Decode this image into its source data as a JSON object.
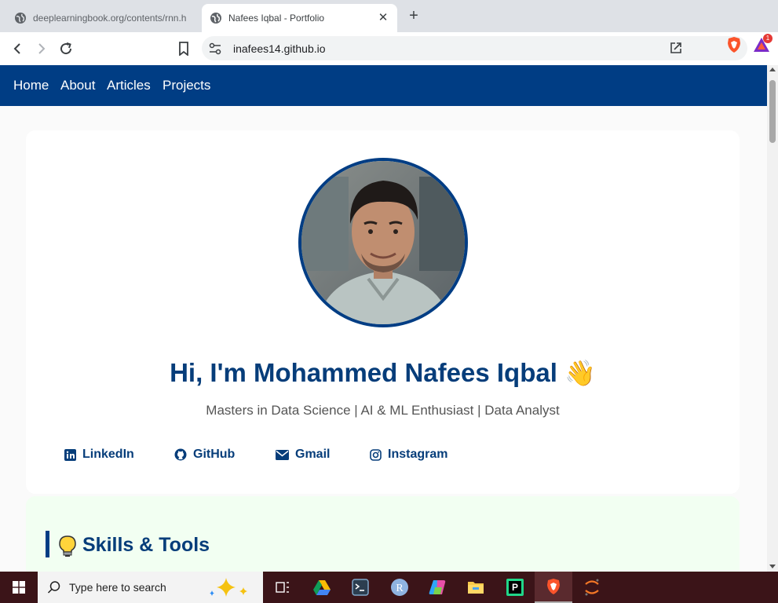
{
  "browser": {
    "tabs": [
      {
        "title": "deeplearningbook.org/contents/rnn.h",
        "active": false
      },
      {
        "title": "Nafees Iqbal - Portfolio",
        "active": true
      }
    ],
    "close_glyph": "✕",
    "newtab_glyph": "+",
    "url": "inafees14.github.io",
    "rewards_badge": "1"
  },
  "nav": {
    "links": [
      "Home",
      "About",
      "Articles",
      "Projects"
    ]
  },
  "hero": {
    "title": "Hi, I'm Mohammed Nafees Iqbal",
    "wave": "👋",
    "subtitle": "Masters in Data Science | AI & ML Enthusiast | Data Analyst",
    "social": [
      {
        "label": "LinkedIn",
        "icon": "linkedin-icon"
      },
      {
        "label": "GitHub",
        "icon": "github-icon"
      },
      {
        "label": "Gmail",
        "icon": "envelope-icon"
      },
      {
        "label": "Instagram",
        "icon": "instagram-icon"
      }
    ]
  },
  "skills": {
    "title": "Skills & Tools",
    "icon": "lightbulb-icon"
  },
  "taskbar": {
    "search_placeholder": "Type here to search",
    "apps": [
      "task-view",
      "google-drive",
      "terminal",
      "r-language",
      "microsoft-copilot",
      "file-explorer",
      "pycharm",
      "brave-browser",
      "jupyter"
    ]
  },
  "colors": {
    "navbar": "#003d84",
    "heading": "#063d7a",
    "skills_bg": "#f2fff2",
    "taskbar": "#3b1418"
  }
}
